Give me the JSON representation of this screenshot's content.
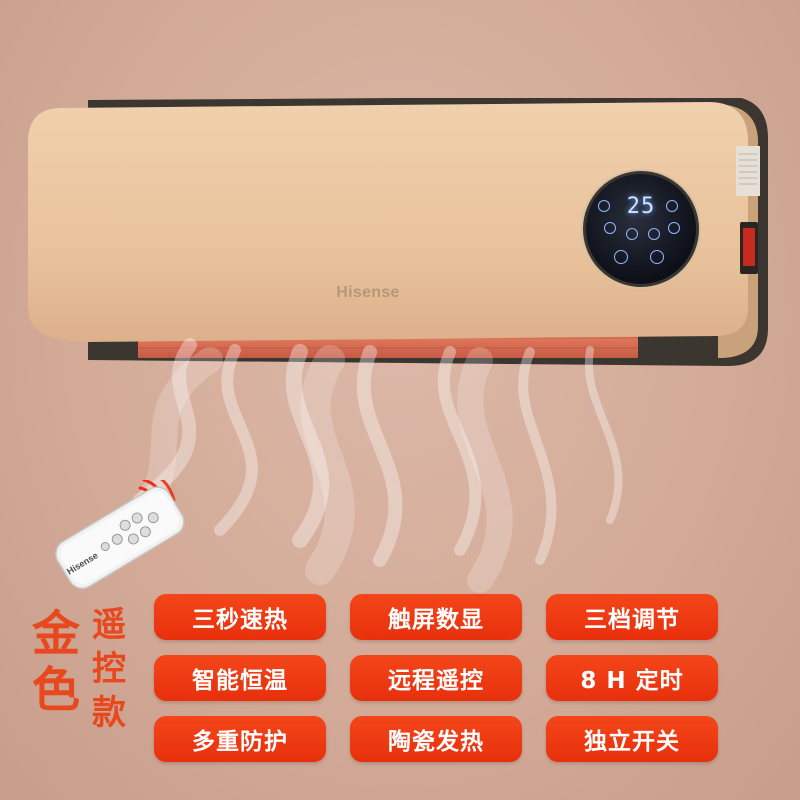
{
  "product": {
    "brand": "Hisense",
    "display_temperature": "25",
    "remote_brand": "Hisense"
  },
  "side_label": {
    "color_chars": [
      "金",
      "色"
    ],
    "type_chars": [
      "遥",
      "控",
      "款"
    ]
  },
  "features": [
    "三秒速热",
    "触屏数显",
    "三档调节",
    "智能恒温",
    "远程遥控",
    "8 H 定时",
    "多重防护",
    "陶瓷发热",
    "独立开关"
  ],
  "colors": {
    "heater_body": "#e8c4a0",
    "badge": "#f0401a",
    "accent_text": "#e8481e",
    "background": "#d6ae9b"
  }
}
